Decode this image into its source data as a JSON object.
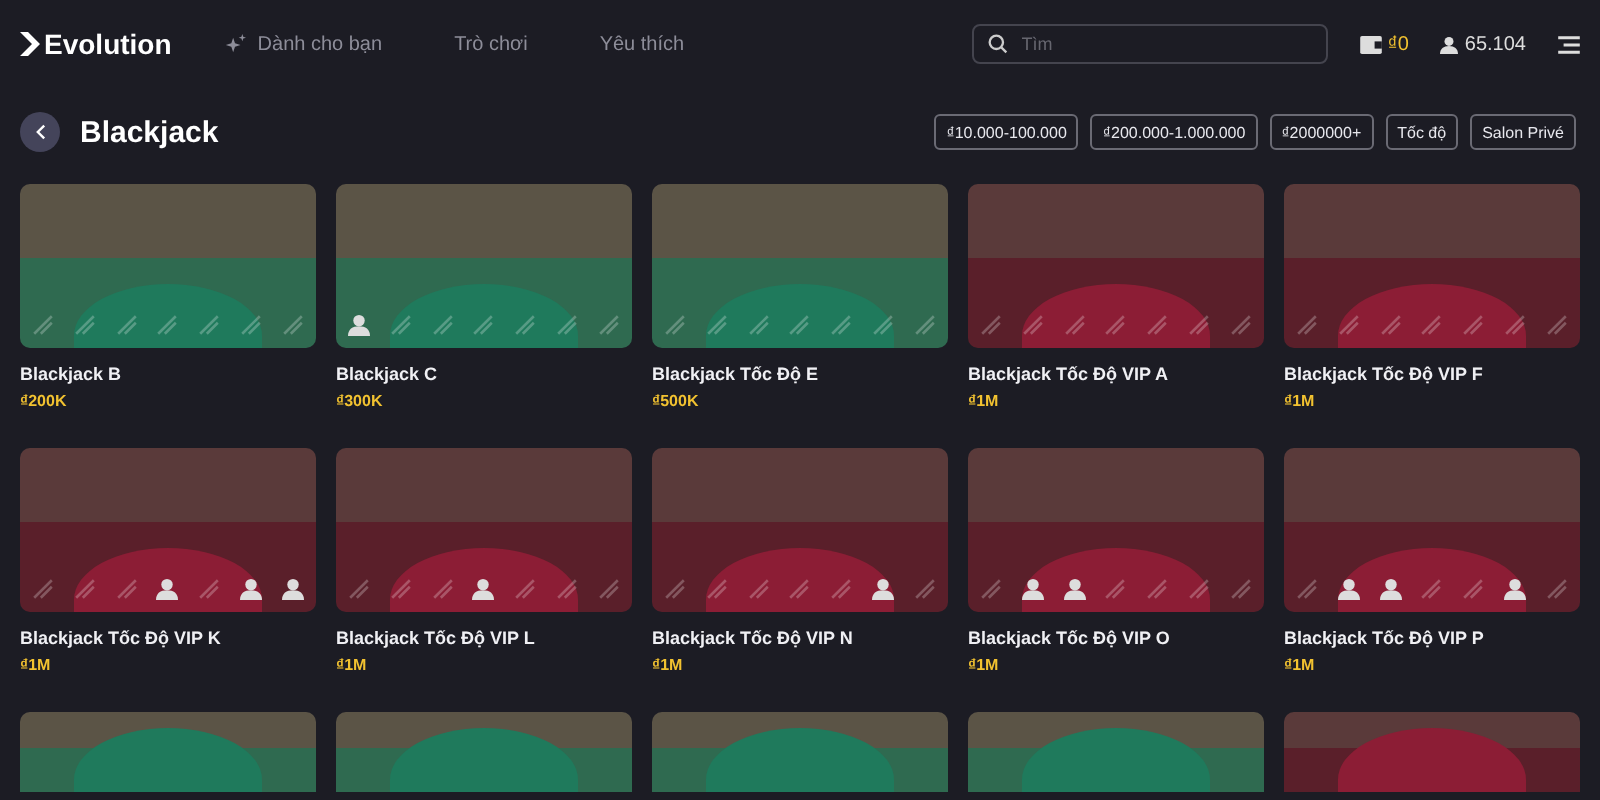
{
  "header": {
    "logo": "Evolution",
    "nav": [
      {
        "label": "Dành cho bạn",
        "selected": false
      },
      {
        "label": "Trò chơi",
        "selected": false
      },
      {
        "label": "Yêu thích",
        "selected": false
      }
    ],
    "search": {
      "placeholder": "Tìm"
    },
    "balance": "₫0",
    "players": "65.104"
  },
  "page": {
    "title": "Blackjack",
    "filters": [
      {
        "label": "₫10.000-100.000",
        "selected": false
      },
      {
        "label": "₫200.000-1.000.000",
        "selected": false
      },
      {
        "label": "₫2000000+",
        "selected": false
      },
      {
        "label": "Tốc độ",
        "selected": false
      },
      {
        "label": "Salon Privé",
        "selected": false
      }
    ]
  },
  "games": [
    {
      "name": "Blackjack B",
      "stake": "₫200K",
      "kind": "green",
      "seats": [
        false,
        false,
        false,
        false,
        false,
        false,
        false
      ]
    },
    {
      "name": "Blackjack C",
      "stake": "₫300K",
      "kind": "green",
      "seats": [
        true,
        false,
        false,
        false,
        false,
        false,
        false
      ]
    },
    {
      "name": "Blackjack Tốc Độ E",
      "stake": "₫500K",
      "kind": "green",
      "seats": [
        false,
        false,
        false,
        false,
        false,
        false,
        false
      ]
    },
    {
      "name": "Blackjack Tốc Độ VIP A",
      "stake": "₫1M",
      "kind": "red",
      "seats": [
        false,
        false,
        false,
        false,
        false,
        false,
        false
      ]
    },
    {
      "name": "Blackjack Tốc Độ VIP F",
      "stake": "₫1M",
      "kind": "red",
      "seats": [
        false,
        false,
        false,
        false,
        false,
        false,
        false
      ]
    },
    {
      "name": "Blackjack Tốc Độ VIP K",
      "stake": "₫1M",
      "kind": "red",
      "seats": [
        false,
        false,
        false,
        true,
        false,
        true,
        true
      ]
    },
    {
      "name": "Blackjack Tốc Độ VIP L",
      "stake": "₫1M",
      "kind": "red",
      "seats": [
        false,
        false,
        false,
        true,
        false,
        false,
        false
      ]
    },
    {
      "name": "Blackjack Tốc Độ VIP N",
      "stake": "₫1M",
      "kind": "red",
      "seats": [
        false,
        false,
        false,
        false,
        false,
        true,
        false
      ]
    },
    {
      "name": "Blackjack Tốc Độ VIP O",
      "stake": "₫1M",
      "kind": "red",
      "seats": [
        false,
        true,
        true,
        false,
        false,
        false,
        false
      ]
    },
    {
      "name": "Blackjack Tốc Độ VIP P",
      "stake": "₫1M",
      "kind": "red",
      "seats": [
        false,
        true,
        true,
        false,
        false,
        true,
        false
      ]
    },
    {
      "kind": "green"
    },
    {
      "kind": "green"
    },
    {
      "kind": "green"
    },
    {
      "kind": "green"
    },
    {
      "kind": "red"
    }
  ]
}
